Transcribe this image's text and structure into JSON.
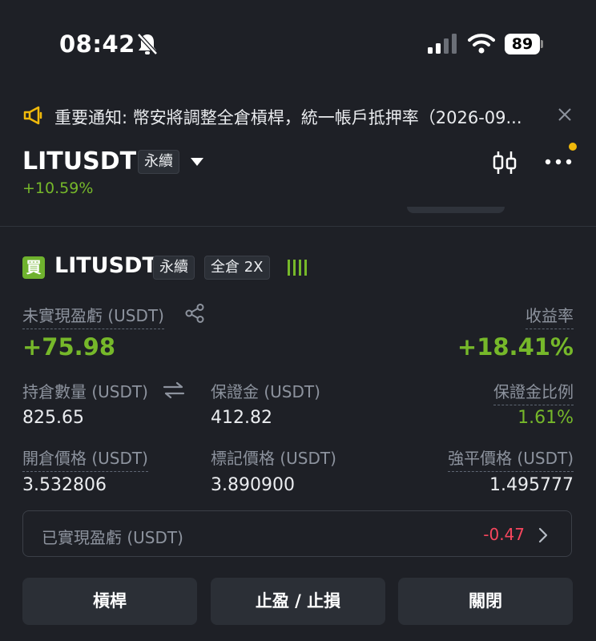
{
  "status_bar": {
    "time": "08:42",
    "battery": "89"
  },
  "notice": {
    "text": "重要通知: 幣安將調整全倉槓桿，統一帳戶抵押率（2026-09..."
  },
  "header": {
    "symbol": "LITUSDT",
    "contract_tag": "永續",
    "change": "+10.59%"
  },
  "position": {
    "side_badge": "買",
    "symbol": "LITUSDT",
    "contract_tag": "永續",
    "margin_tag": "全倉 2X",
    "unrealized_label": "未實現盈虧 (USDT)",
    "unrealized_value": "+75.98",
    "roe_label": "收益率",
    "roe_value": "+18.41%",
    "size_label": "持倉數量 (USDT)",
    "size_value": "825.65",
    "margin_label": "保證金 (USDT)",
    "margin_value": "412.82",
    "margin_ratio_label": "保證金比例",
    "margin_ratio_value": "1.61%",
    "entry_label": "開倉價格 (USDT)",
    "entry_value": "3.532806",
    "mark_label": "標記價格 (USDT)",
    "mark_value": "3.890900",
    "liq_label": "強平價格 (USDT)",
    "liq_value": "1.495777",
    "realized_label": "已實現盈虧 (USDT)",
    "realized_value": "-0.47"
  },
  "actions": {
    "leverage": "槓桿",
    "tpsl": "止盈 / 止損",
    "close": "關閉"
  },
  "colors": {
    "background": "#1e2026",
    "positive": "#76b82a",
    "negative": "#f6465d",
    "accent": "#f0b90b"
  },
  "icons": [
    "bell-slash-icon",
    "signal-icon",
    "wifi-icon",
    "megaphone-icon",
    "close-icon",
    "caret-down-icon",
    "candlestick-icon",
    "more-icon",
    "share-icon",
    "swap-icon",
    "chevron-right-icon"
  ]
}
